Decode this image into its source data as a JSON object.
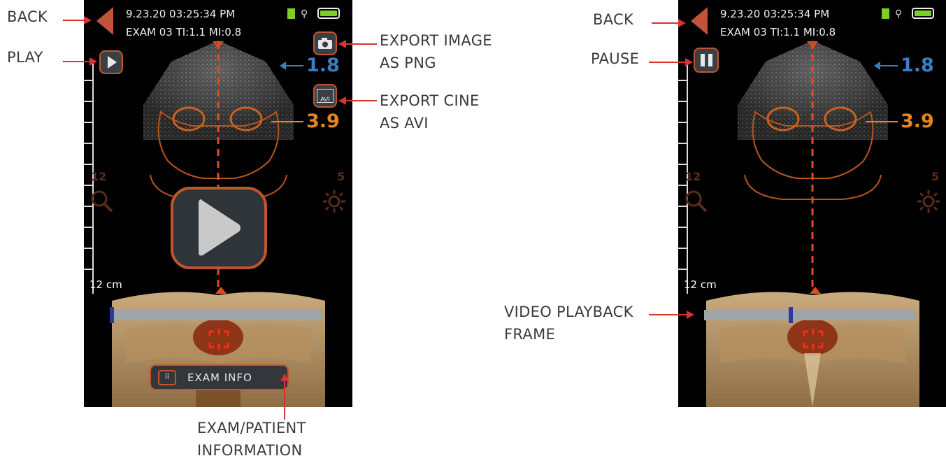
{
  "callouts": {
    "back_left": "BACK",
    "play": "PLAY",
    "export_image": [
      "EXPORT IMAGE",
      "AS PNG"
    ],
    "export_cine": [
      "EXPORT CINE",
      "AS AVI"
    ],
    "exam_info": [
      "EXAM/PATIENT",
      "INFORMATION"
    ],
    "back_right": "BACK",
    "pause": "PAUSE",
    "playback_frame": [
      "VIDEO PLAYBACK",
      "FRAME"
    ]
  },
  "screen_left": {
    "datetime": "9.23.20   03:25:34 PM",
    "exam_line": "EXAM 03  TI:1.1  MI:0.8",
    "depth_blue": "1.8",
    "depth_orange": "3.9",
    "zoom_value": "12",
    "brightness_value": "5",
    "depth_cm": "12 cm",
    "avi_label": "AVI",
    "exam_button_label": "EXAM INFO",
    "playback_position": 0.0
  },
  "screen_right": {
    "datetime": "9.23.20   03:25:34 PM",
    "exam_line": "EXAM 03  TI:1.1  MI:0.8",
    "depth_blue": "1.8",
    "depth_orange": "3.9",
    "zoom_value": "12",
    "brightness_value": "5",
    "depth_cm": "12 cm",
    "playback_position": 0.41
  },
  "colors": {
    "accent_orange": "#c0562f",
    "callout_line": "#d7332f",
    "depth_blue": "#3b7fc0",
    "depth_orange": "#e8861e",
    "battery_green": "#7ccf2a"
  },
  "icons": [
    "back-icon",
    "play-icon",
    "pause-icon",
    "camera-icon",
    "avi-icon",
    "zoom-icon",
    "brightness-icon",
    "keyboard-icon",
    "battery-icon",
    "usb-icon",
    "sd-card-icon",
    "target-icon"
  ]
}
